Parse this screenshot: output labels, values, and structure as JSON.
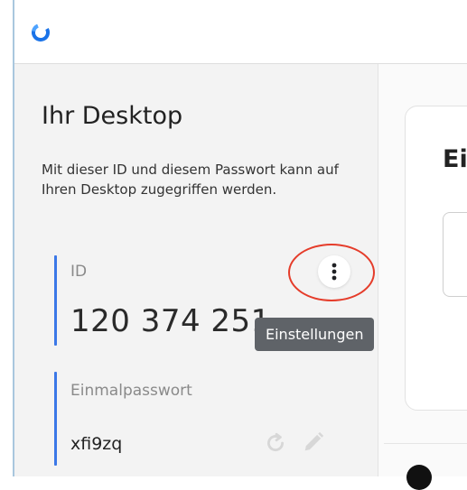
{
  "sidebar": {
    "title": "Ihr Desktop",
    "description": "Mit dieser ID und diesem Passwort kann auf Ihren Desktop zugegriffen werden.",
    "id_label": "ID",
    "id_value": "120 374 251",
    "password_label": "Einmalpasswort",
    "password_value": "xfi9zq",
    "menu_icon": "more-vertical-icon",
    "refresh_icon": "refresh-icon",
    "edit_icon": "pencil-icon"
  },
  "tooltip": {
    "text": "Einstellungen"
  },
  "main": {
    "card_heading_partial": "Ei"
  },
  "colors": {
    "accent_line": "#3b78e7",
    "logo": "#1a73e8",
    "annotation": "#e53c2a",
    "tooltip_bg": "#5f6368"
  }
}
